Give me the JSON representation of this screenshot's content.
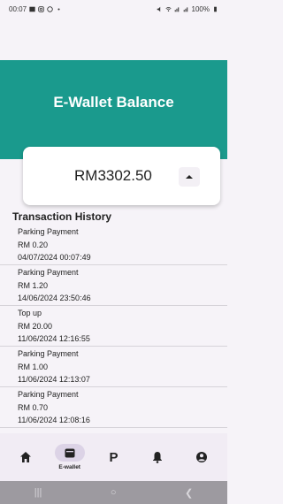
{
  "status_bar": {
    "time": "00:07",
    "battery": "100%"
  },
  "header": {
    "title": "E-Wallet Balance"
  },
  "balance": {
    "amount": "RM3302.50"
  },
  "transactions": {
    "title": "Transaction History",
    "items": [
      {
        "type": "Parking Payment",
        "amount": "RM 0.20",
        "datetime": "04/07/2024 00:07:49"
      },
      {
        "type": "Parking Payment",
        "amount": "RM 1.20",
        "datetime": "14/06/2024 23:50:46"
      },
      {
        "type": "Top up",
        "amount": "RM 20.00",
        "datetime": "11/06/2024 12:16:55"
      },
      {
        "type": "Parking Payment",
        "amount": "RM 1.00",
        "datetime": "11/06/2024 12:13:07"
      },
      {
        "type": "Parking Payment",
        "amount": "RM 0.70",
        "datetime": "11/06/2024 12:08:16"
      }
    ]
  },
  "bottom_nav": {
    "items": [
      {
        "icon": "home-icon"
      },
      {
        "icon": "wallet-icon",
        "label": "E-wallet",
        "active": true
      },
      {
        "text": "P"
      },
      {
        "icon": "bell-icon"
      },
      {
        "icon": "account-icon"
      }
    ]
  },
  "colors": {
    "header": "#1a9a8d",
    "nav_background": "#f1ecf4",
    "active_pill": "#dcd3e6",
    "system_nav": "#9d9aa0"
  }
}
